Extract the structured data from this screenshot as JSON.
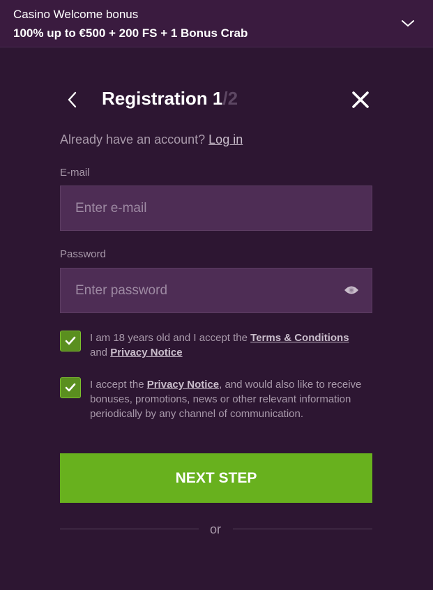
{
  "banner": {
    "title": "Casino Welcome bonus",
    "offer": "100% up to €500 + 200 FS + 1 Bonus Crab",
    "expand_icon": "chevron-down-icon"
  },
  "header": {
    "back_icon": "chevron-left-icon",
    "title": "Registration 1",
    "step_total": "/2",
    "close_icon": "close-icon"
  },
  "account": {
    "prompt": "Already have an account?",
    "login_label": "Log in"
  },
  "email": {
    "label": "E-mail",
    "placeholder": "Enter e-mail",
    "value": ""
  },
  "password": {
    "label": "Password",
    "placeholder": "Enter password",
    "value": "",
    "toggle_icon": "eye-icon"
  },
  "consents": [
    {
      "checked": true,
      "text_before": "I am 18 years old and I accept the ",
      "link1": "Terms & Conditions",
      "text_mid": " and ",
      "link2": "Privacy Notice"
    },
    {
      "checked": true,
      "text_before": "I accept the ",
      "link1": "Privacy Notice",
      "text_after": ", and would also like to receive bonuses, promotions, news or other relevant information periodically by any channel of communication."
    }
  ],
  "submit": {
    "label": "NEXT STEP"
  },
  "divider": {
    "label": "or"
  },
  "colors": {
    "background": "#2d1632",
    "banner": "#3a1b3f",
    "input": "#4e2d55",
    "accent_green": "#68b11e",
    "checkbox_green": "#5a8f1f",
    "muted_text": "#a899aa",
    "step_total": "#5d4763"
  }
}
